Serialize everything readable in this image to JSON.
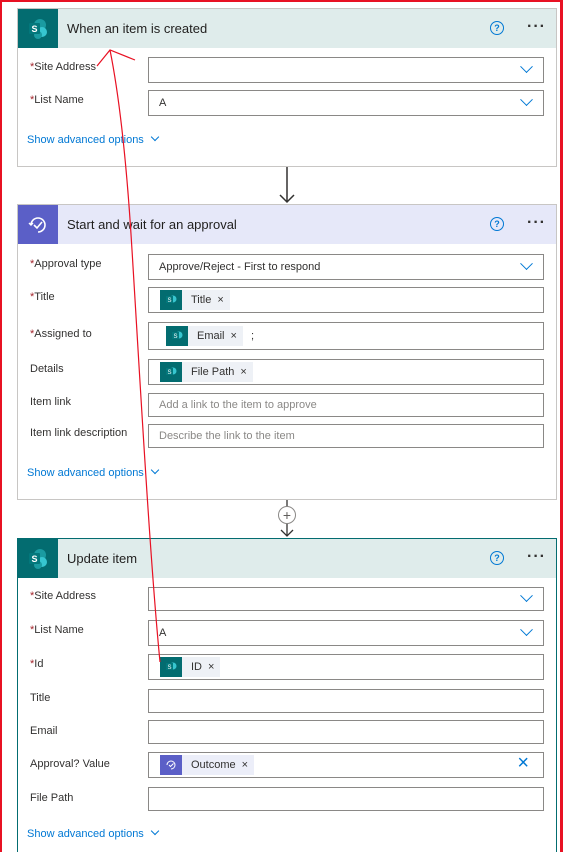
{
  "trigger": {
    "title": "When an item is created",
    "site_label": "Site Address",
    "site_value": "",
    "list_label": "List Name",
    "list_value": "A",
    "advanced": "Show advanced options"
  },
  "approval": {
    "title": "Start and wait for an approval",
    "type_label": "Approval type",
    "type_value": "Approve/Reject - First to respond",
    "title_label": "Title",
    "title_token": "Title",
    "assigned_label": "Assigned to",
    "assigned_token": "Email",
    "assigned_suffix": ";",
    "details_label": "Details",
    "details_token": "File Path",
    "itemlink_label": "Item link",
    "itemlink_placeholder": "Add a link to the item to approve",
    "itemlinkdesc_label": "Item link description",
    "itemlinkdesc_placeholder": "Describe the link to the item",
    "advanced": "Show advanced options"
  },
  "update": {
    "title": "Update item",
    "site_label": "Site Address",
    "list_label": "List Name",
    "list_value": "A",
    "id_label": "Id",
    "id_token": "ID",
    "title_label": "Title",
    "email_label": "Email",
    "approval_label": "Approval? Value",
    "approval_token": "Outcome",
    "filepath_label": "File Path",
    "advanced": "Show advanced options"
  },
  "common": {
    "help_glyph": "?",
    "more_glyph": "···",
    "remove_glyph": "×",
    "required_mark": "*",
    "add_glyph": "+"
  },
  "colors": {
    "sharepoint": "#036c70",
    "approval": "#5b5fc7",
    "link": "#0078d4",
    "annotation": "#e81123"
  }
}
